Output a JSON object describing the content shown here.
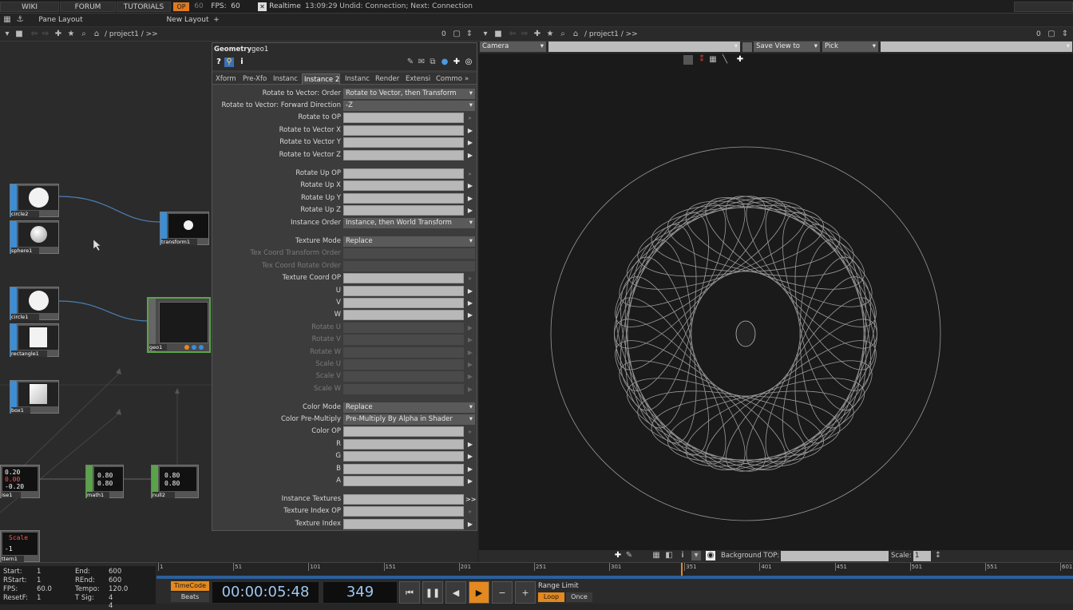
{
  "topbar": {
    "wiki": "WIKI",
    "forum": "FORUM",
    "tutorials": "TUTORIALS",
    "perf_badge": "OP",
    "fps_cap": "60",
    "fps_label": "FPS:",
    "fps_value": "60",
    "realtime_label": "Realtime",
    "status": "13:09:29 Undid: Connection; Next: Connection"
  },
  "pane_bar": {
    "pane_layout": "Pane Layout",
    "new_layout": "New Layout",
    "add": "+"
  },
  "network_pane": {
    "path": "/ project1 / >>",
    "counter": "0"
  },
  "viewer_pane": {
    "path": "/ project1 / >>",
    "counter": "0",
    "camera": "Camera",
    "save_view": "Save View to",
    "pick": "Pick",
    "background_top_label": "Background TOP:",
    "scale_label": "Scale:",
    "scale_value": "1"
  },
  "nodes": {
    "circle2": "circle2",
    "sphere1": "sphere1",
    "transform1": "transform1",
    "circle1": "circle1",
    "rectangle1": "rectangle1",
    "box1": "box1",
    "geo1": "geo1",
    "noise1": "ise1",
    "noise1_vals": [
      "0.20",
      "0.00",
      "-0.20"
    ],
    "math1": "math1",
    "math1_vals": [
      "0.80",
      "0.80"
    ],
    "null2": "null2",
    "null2_vals": [
      "0.80",
      "0.80"
    ],
    "pattern1": "ttern1",
    "pattern1_vals": [
      "Scale",
      "-1"
    ]
  },
  "param": {
    "op_type": "Geometry",
    "op_name": "geo1",
    "tabs": [
      "Xform",
      "Pre-Xfo",
      "Instanc",
      "Instance 2",
      "Instanc",
      "Render",
      "Extensi",
      "Commo",
      "»"
    ],
    "rows": {
      "rot_order_label": "Rotate to Vector: Order",
      "rot_order_value": "Rotate to Vector, then Transform",
      "fwd_dir_label": "Rotate to Vector: Forward Direction",
      "fwd_dir_value": "-Z",
      "rotate_to_op": "Rotate to OP",
      "rotate_to_vector_x": "Rotate to Vector X",
      "rotate_to_vector_y": "Rotate to Vector Y",
      "rotate_to_vector_z": "Rotate to Vector Z",
      "rotate_up_op": "Rotate Up OP",
      "rotate_up_x": "Rotate Up X",
      "rotate_up_y": "Rotate Up Y",
      "rotate_up_z": "Rotate Up Z",
      "instance_order_label": "Instance Order",
      "instance_order_value": "Instance, then World Transform",
      "texture_mode_label": "Texture Mode",
      "texture_mode_value": "Replace",
      "tex_coord_transform_order": "Tex Coord Transform Order",
      "tex_coord_rotate_order": "Tex Coord Rotate Order",
      "texture_coord_op": "Texture Coord OP",
      "u": "U",
      "v": "V",
      "w": "W",
      "rotate_u": "Rotate U",
      "rotate_v": "Rotate V",
      "rotate_w": "Rotate W",
      "scale_u": "Scale U",
      "scale_v": "Scale V",
      "scale_w": "Scale W",
      "color_mode_label": "Color Mode",
      "color_mode_value": "Replace",
      "color_premult_label": "Color Pre-Multiply",
      "color_premult_value": "Pre-Multiply By Alpha in Shader",
      "color_op": "Color OP",
      "r": "R",
      "g": "G",
      "b": "B",
      "a": "A",
      "instance_textures": "Instance Textures",
      "instance_textures_btn": ">>",
      "texture_index_op": "Texture Index OP",
      "texture_index": "Texture Index"
    }
  },
  "timeline": {
    "start_label": "Start:",
    "start_value": "1",
    "end_label": "End:",
    "end_value": "600",
    "rstart_label": "RStart:",
    "rstart_value": "1",
    "rend_label": "REnd:",
    "rend_value": "600",
    "fps_label": "FPS:",
    "fps_value": "60.0",
    "tempo_label": "Tempo:",
    "tempo_value": "120.0",
    "resetf_label": "ResetF:",
    "resetf_value": "1",
    "tsig_label": "T Sig:",
    "tsig_value": "4   4",
    "ticks": [
      "1",
      "51",
      "101",
      "151",
      "201",
      "251",
      "301",
      "351",
      "401",
      "451",
      "501",
      "551",
      "601"
    ],
    "timecode_btn": "TimeCode",
    "beats_btn": "Beats",
    "timecode": "00:00:05:48",
    "frame": "349",
    "range_limit": "Range Limit",
    "loop": "Loop",
    "once": "Once",
    "current_frame": 349,
    "range": [
      1,
      600
    ]
  },
  "colors": {
    "accent_orange": "#e3891f",
    "top_blue": "#3b8ed6",
    "chop_green": "#5aa34a",
    "wire": "#4a7fb5"
  }
}
